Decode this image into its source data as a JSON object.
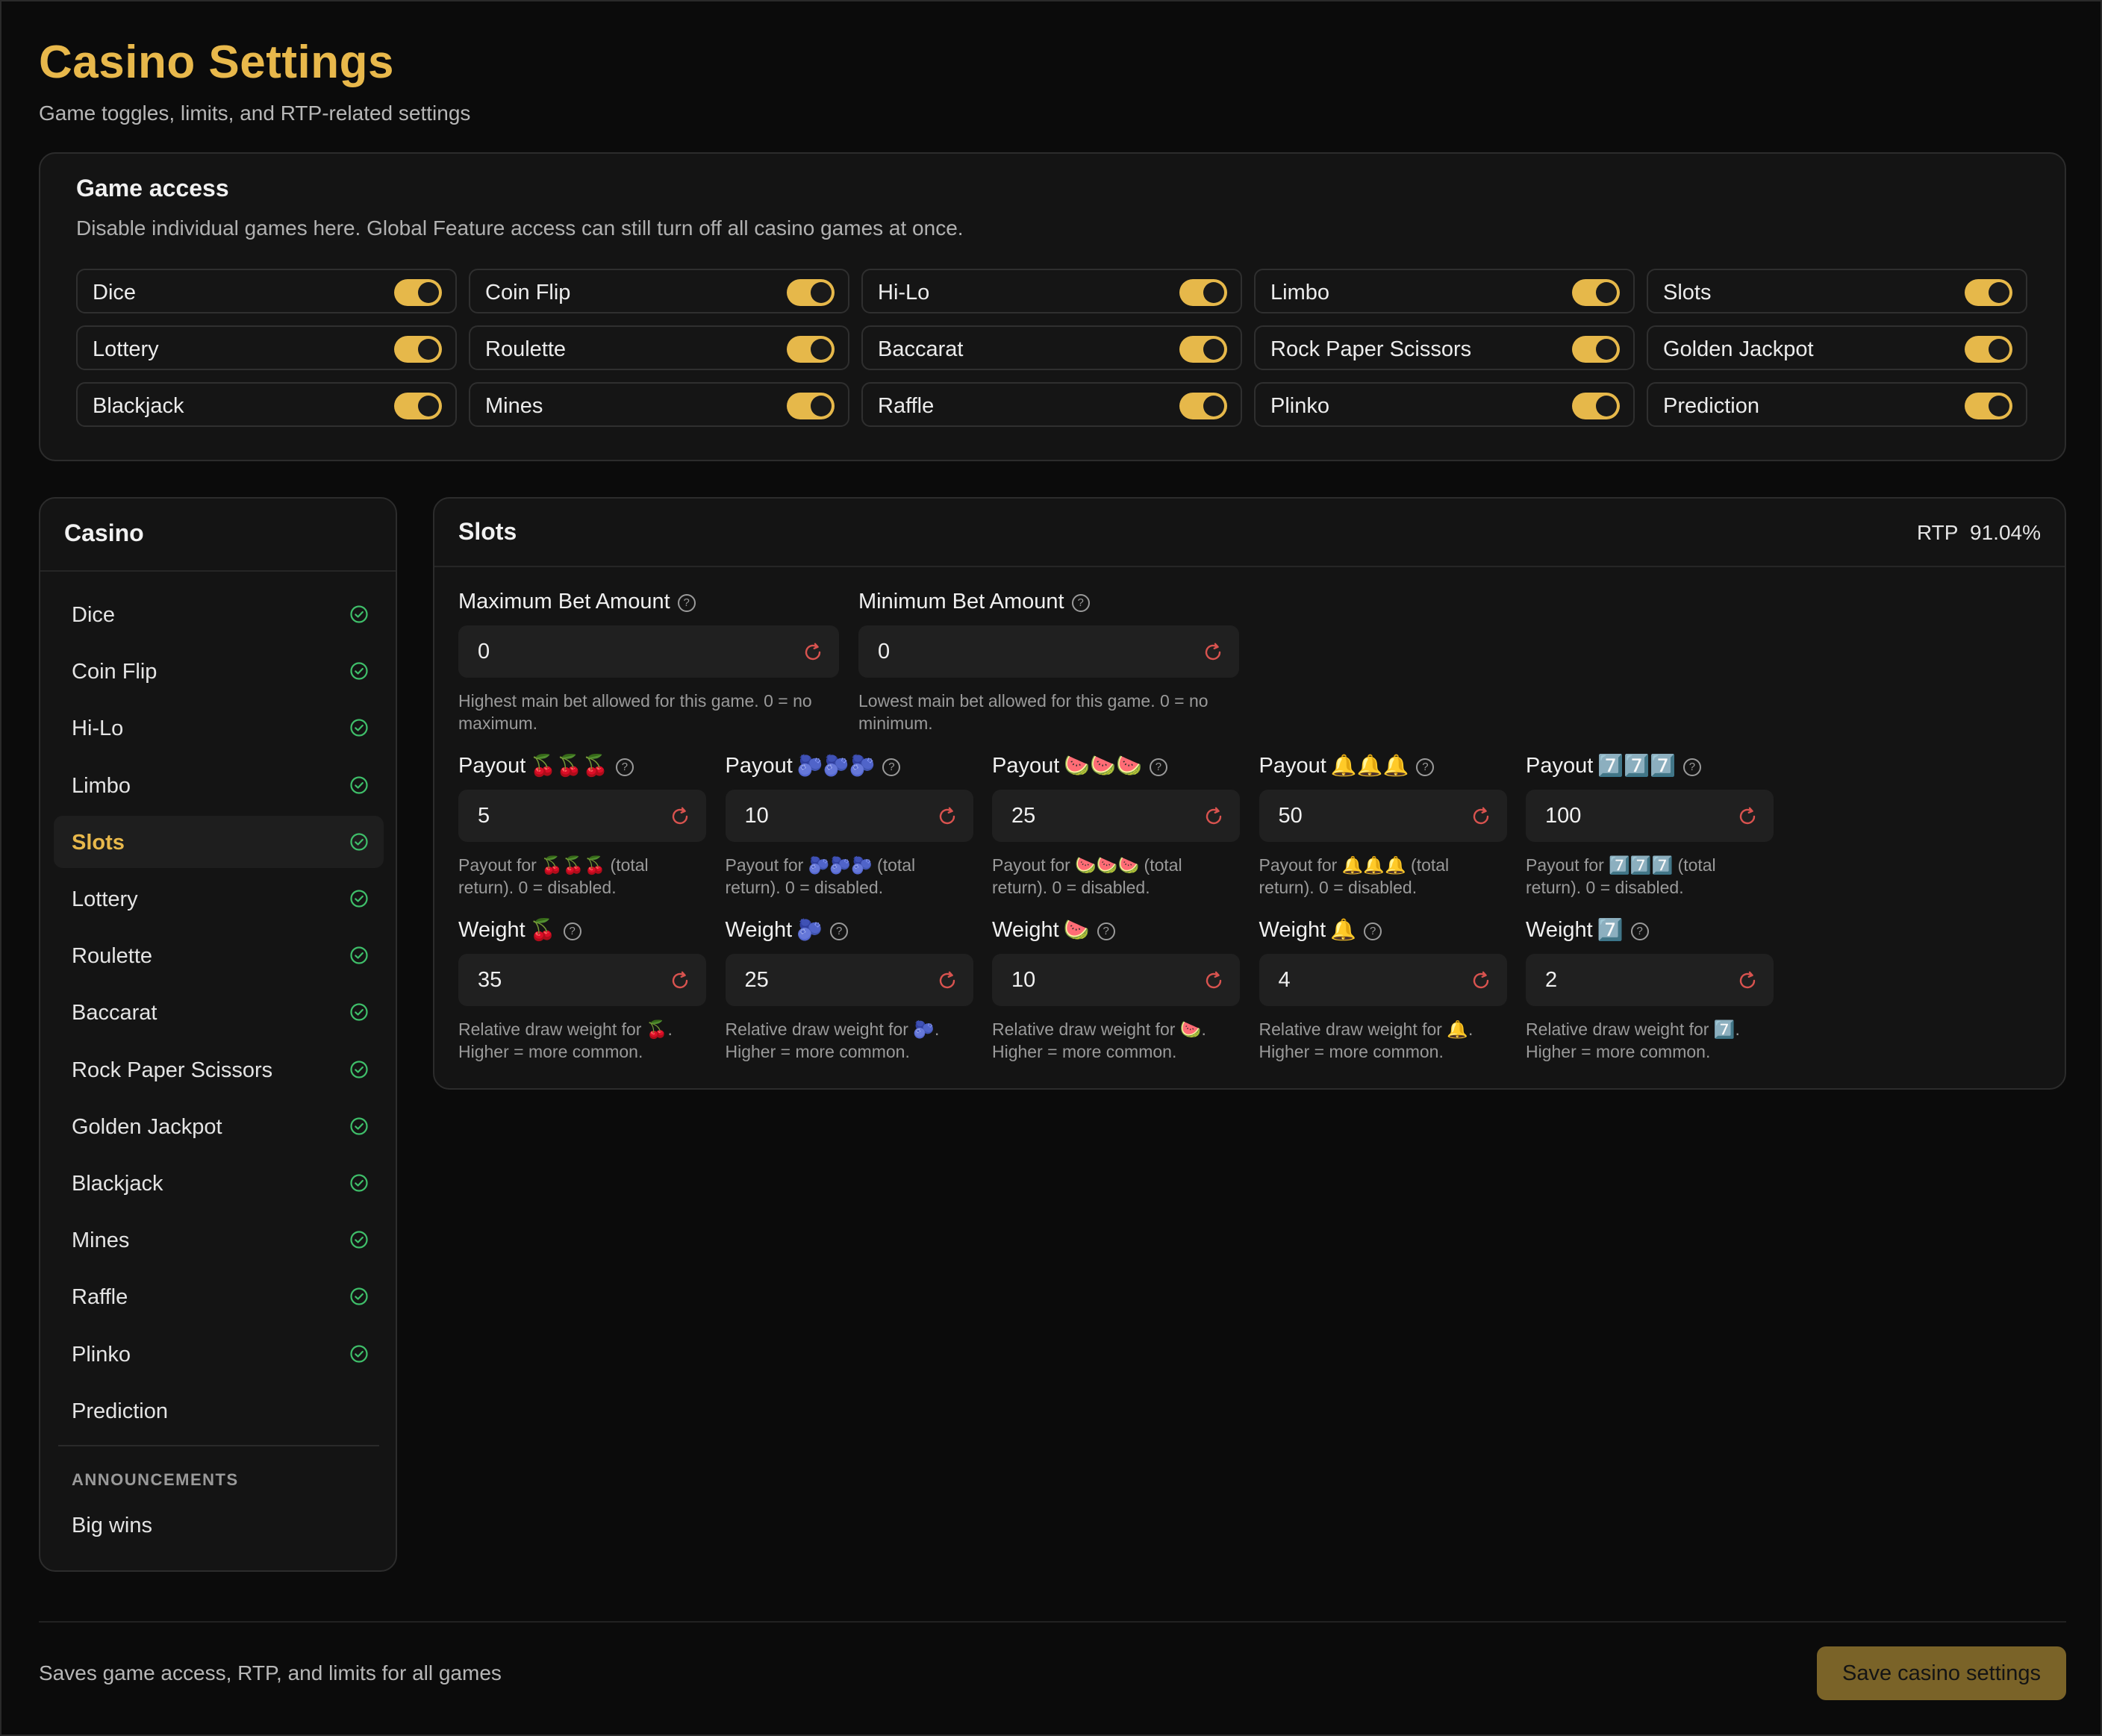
{
  "page": {
    "title": "Casino Settings",
    "subtitle": "Game toggles, limits, and RTP-related settings"
  },
  "colors": {
    "accent": "#e8b84b",
    "check": "#3fbf6a",
    "reset": "#d9534f",
    "save_button": "#7a6328"
  },
  "game_access": {
    "title": "Game access",
    "description": "Disable individual games here. Global Feature access can still turn off all casino games at once.",
    "games": [
      {
        "name": "Dice",
        "enabled": true
      },
      {
        "name": "Coin Flip",
        "enabled": true
      },
      {
        "name": "Hi-Lo",
        "enabled": true
      },
      {
        "name": "Limbo",
        "enabled": true
      },
      {
        "name": "Slots",
        "enabled": true
      },
      {
        "name": "Lottery",
        "enabled": true
      },
      {
        "name": "Roulette",
        "enabled": true
      },
      {
        "name": "Baccarat",
        "enabled": true
      },
      {
        "name": "Rock Paper Scissors",
        "enabled": true
      },
      {
        "name": "Golden Jackpot",
        "enabled": true
      },
      {
        "name": "Blackjack",
        "enabled": true
      },
      {
        "name": "Mines",
        "enabled": true
      },
      {
        "name": "Raffle",
        "enabled": true
      },
      {
        "name": "Plinko",
        "enabled": true
      },
      {
        "name": "Prediction",
        "enabled": true
      }
    ]
  },
  "sidebar": {
    "title": "Casino",
    "items": [
      {
        "label": "Dice",
        "checked": true
      },
      {
        "label": "Coin Flip",
        "checked": true
      },
      {
        "label": "Hi-Lo",
        "checked": true
      },
      {
        "label": "Limbo",
        "checked": true
      },
      {
        "label": "Slots",
        "checked": true,
        "active": true
      },
      {
        "label": "Lottery",
        "checked": true
      },
      {
        "label": "Roulette",
        "checked": true
      },
      {
        "label": "Baccarat",
        "checked": true
      },
      {
        "label": "Rock Paper Scissors",
        "checked": true
      },
      {
        "label": "Golden Jackpot",
        "checked": true
      },
      {
        "label": "Blackjack",
        "checked": true
      },
      {
        "label": "Mines",
        "checked": true
      },
      {
        "label": "Raffle",
        "checked": true
      },
      {
        "label": "Plinko",
        "checked": true
      },
      {
        "label": "Prediction",
        "checked": false
      }
    ],
    "announcements_heading": "ANNOUNCEMENTS",
    "announcements": [
      {
        "label": "Big wins"
      }
    ]
  },
  "main": {
    "title": "Slots",
    "rtp_label": "RTP",
    "rtp_value": "91.04%",
    "bet_fields": [
      {
        "label": "Maximum Bet Amount",
        "value": "0",
        "help": "Highest main bet allowed for this game. 0 = no maximum."
      },
      {
        "label": "Minimum Bet Amount",
        "value": "0",
        "help": "Lowest main bet allowed for this game. 0 = no minimum."
      }
    ],
    "payouts": [
      {
        "label": "Payout",
        "emoji": "🍒🍒🍒",
        "value": "5",
        "help": "Payout for 🍒🍒🍒 (total return). 0 = disabled."
      },
      {
        "label": "Payout",
        "emoji": "🫐🫐🫐",
        "value": "10",
        "help": "Payout for 🫐🫐🫐 (total return). 0 = disabled."
      },
      {
        "label": "Payout",
        "emoji": "🍉🍉🍉",
        "value": "25",
        "help": "Payout for 🍉🍉🍉 (total return). 0 = disabled."
      },
      {
        "label": "Payout",
        "emoji": "🔔🔔🔔",
        "value": "50",
        "help": "Payout for 🔔🔔🔔 (total return). 0 = disabled."
      },
      {
        "label": "Payout",
        "emoji": "7️⃣7️⃣7️⃣",
        "value": "100",
        "help": "Payout for 7️⃣7️⃣7️⃣ (total return). 0 = disabled."
      }
    ],
    "weights": [
      {
        "label": "Weight",
        "emoji": "🍒",
        "value": "35",
        "help": "Relative draw weight for 🍒. Higher = more common."
      },
      {
        "label": "Weight",
        "emoji": "🫐",
        "value": "25",
        "help": "Relative draw weight for 🫐. Higher = more common."
      },
      {
        "label": "Weight",
        "emoji": "🍉",
        "value": "10",
        "help": "Relative draw weight for 🍉. Higher = more common."
      },
      {
        "label": "Weight",
        "emoji": "🔔",
        "value": "4",
        "help": "Relative draw weight for 🔔. Higher = more common."
      },
      {
        "label": "Weight",
        "emoji": "7️⃣",
        "value": "2",
        "help": "Relative draw weight for 7️⃣. Higher = more common."
      }
    ]
  },
  "footer": {
    "note": "Saves game access, RTP, and limits for all games",
    "save_label": "Save casino settings"
  }
}
